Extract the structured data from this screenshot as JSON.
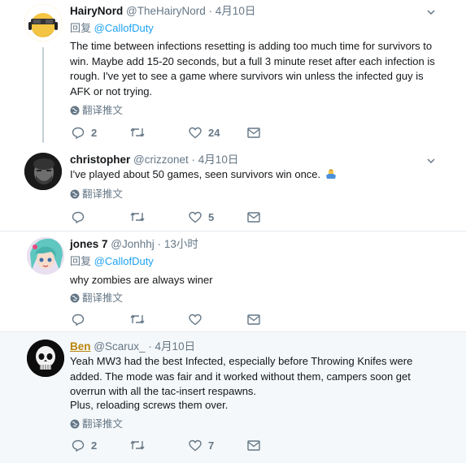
{
  "translate_label": "翻译推文",
  "reply_prefix": "回复",
  "separator_dot": "·",
  "tweets": [
    {
      "name": "HairyNord",
      "handle": "@TheHairyNord",
      "time": "4月10日",
      "reply_to": "@CallofDuty",
      "text": "The time between infections resetting is adding too much time for survivors to win. Maybe add 15-20 seconds, but a full 3 minute reset after each infection is rough. I've yet to see a game where survivors win unless the infected guy is AFK or not trying.",
      "replies": "2",
      "retweets": "",
      "likes": "24"
    },
    {
      "name": "christopher",
      "handle": "@crizzonet",
      "time": "4月10日",
      "text": "I've played about 50 games, seen survivors win once.",
      "emoji": "person-shrugging-emoji",
      "replies": "",
      "retweets": "",
      "likes": "5"
    },
    {
      "name": "jones 7",
      "handle": "@Jonhhj",
      "time": "13小时",
      "reply_to": "@CallofDuty",
      "text": "why zombies are always winer",
      "replies": "",
      "retweets": "",
      "likes": ""
    },
    {
      "name": "Ben",
      "handle": "@Scarux_",
      "time": "4月10日",
      "text": "Yeah MW3 had the best Infected, especially before Throwing Knifes were added. The mode was fair and it worked without them, campers soon get overrun with all the tac-insert respawns.",
      "text2": "Plus, reloading screws them over.",
      "replies": "2",
      "retweets": "",
      "likes": "7"
    }
  ],
  "colors": {
    "link": "#1da1f2",
    "muted": "#657786",
    "thread_line": "#c4cfd6",
    "highlight_bg": "#f5f8fa"
  }
}
